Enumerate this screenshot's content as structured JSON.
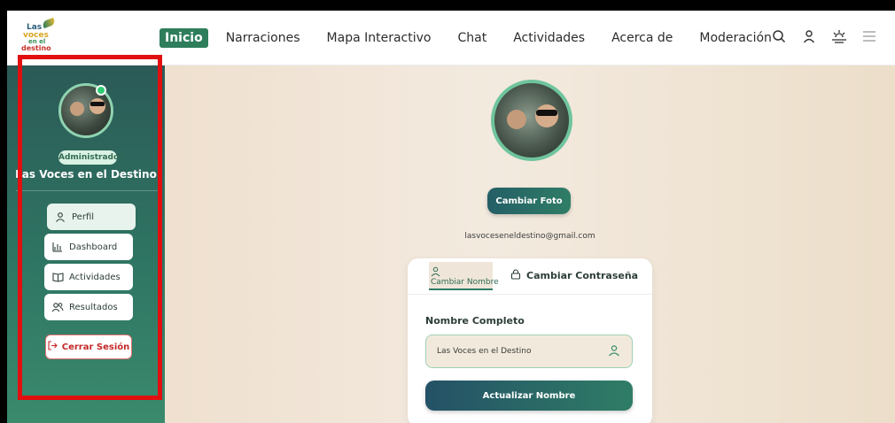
{
  "logo": {
    "line1": "Las",
    "line2": "voces",
    "line3": "en el",
    "line4": "destino"
  },
  "nav": {
    "items": [
      "Inicio",
      "Narraciones",
      "Mapa Interactivo",
      "Chat",
      "Actividades",
      "Acerca de",
      "Moderación"
    ],
    "active": "Inicio"
  },
  "top_icons": [
    "search-icon",
    "user-icon",
    "sun-horizon-icon",
    "menu-icon"
  ],
  "sidebar": {
    "role": "Administrador",
    "user_name": "Las Voces en el Destino",
    "items": [
      {
        "label": "Perfil",
        "icon": "user-icon"
      },
      {
        "label": "Dashboard",
        "icon": "chart-icon"
      },
      {
        "label": "Actividades",
        "icon": "book-icon"
      },
      {
        "label": "Resultados",
        "icon": "users-icon"
      }
    ],
    "logout": "Cerrar Sesión"
  },
  "profile": {
    "change_photo": "Cambiar Foto",
    "email": "lasvoceseneldestino@gmail.com"
  },
  "card": {
    "tabs": {
      "name": "Cambiar Nombre",
      "password": "Cambiar Contraseña"
    },
    "field_label": "Nombre Completo",
    "field_value": "Las Voces en el Destino",
    "submit": "Actualizar Nombre"
  },
  "colors": {
    "brand_green": "#2e7d5b",
    "highlight_red": "#e10f0f",
    "logout_red": "#c62828"
  }
}
